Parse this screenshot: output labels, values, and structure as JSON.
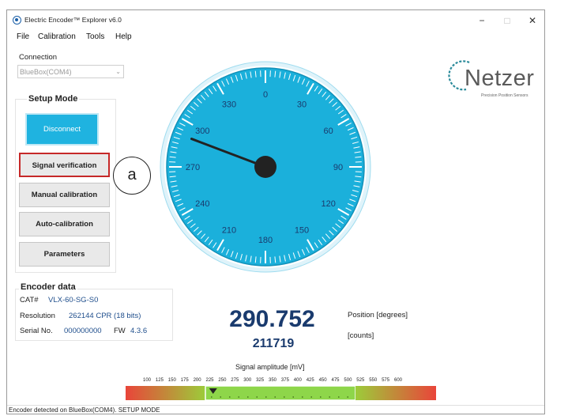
{
  "window": {
    "title": "Electric Encoder™ Explorer v6.0",
    "minimize": "−",
    "maximize": "□",
    "close": "✕"
  },
  "menu": [
    "File",
    "Calibration",
    "Tools",
    "Help"
  ],
  "connection": {
    "label": "Connection",
    "selected": "BlueBox(COM4)"
  },
  "setup_mode": {
    "title": "Setup Mode",
    "disconnect": "Disconnect",
    "buttons": [
      "Signal verification",
      "Manual calibration",
      "Auto-calibration",
      "Parameters"
    ]
  },
  "annotation": "a",
  "gauge": {
    "labels": [
      "0",
      "30",
      "60",
      "90",
      "120",
      "150",
      "180",
      "210",
      "240",
      "270",
      "300",
      "330"
    ],
    "needle_degrees": 290.752
  },
  "logo": {
    "name": "Netzer",
    "tagline": "Precision Position Sensors"
  },
  "encoder_data": {
    "title": "Encoder data",
    "cat_label": "CAT#",
    "cat_value": "VLX-60-SG-S0",
    "resolution_label": "Resolution",
    "resolution_value": "262144 CPR (18 bits)",
    "serial_label": "Serial No.",
    "serial_value": "000000000",
    "fw_label": "FW",
    "fw_value": "4.3.6"
  },
  "readout": {
    "position": "290.752",
    "position_label": "Position [degrees]",
    "counts": "211719",
    "counts_label": "[counts]"
  },
  "signal": {
    "title": "Signal amplitude [mV]",
    "ticks": [
      "100",
      "125",
      "150",
      "175",
      "200",
      "225",
      "250",
      "275",
      "300",
      "325",
      "350",
      "375",
      "400",
      "425",
      "450",
      "475",
      "500",
      "525",
      "550",
      "575",
      "600"
    ],
    "indicator_mv": 225
  },
  "status": "Encoder detected on BlueBox(COM4). SETUP MODE"
}
